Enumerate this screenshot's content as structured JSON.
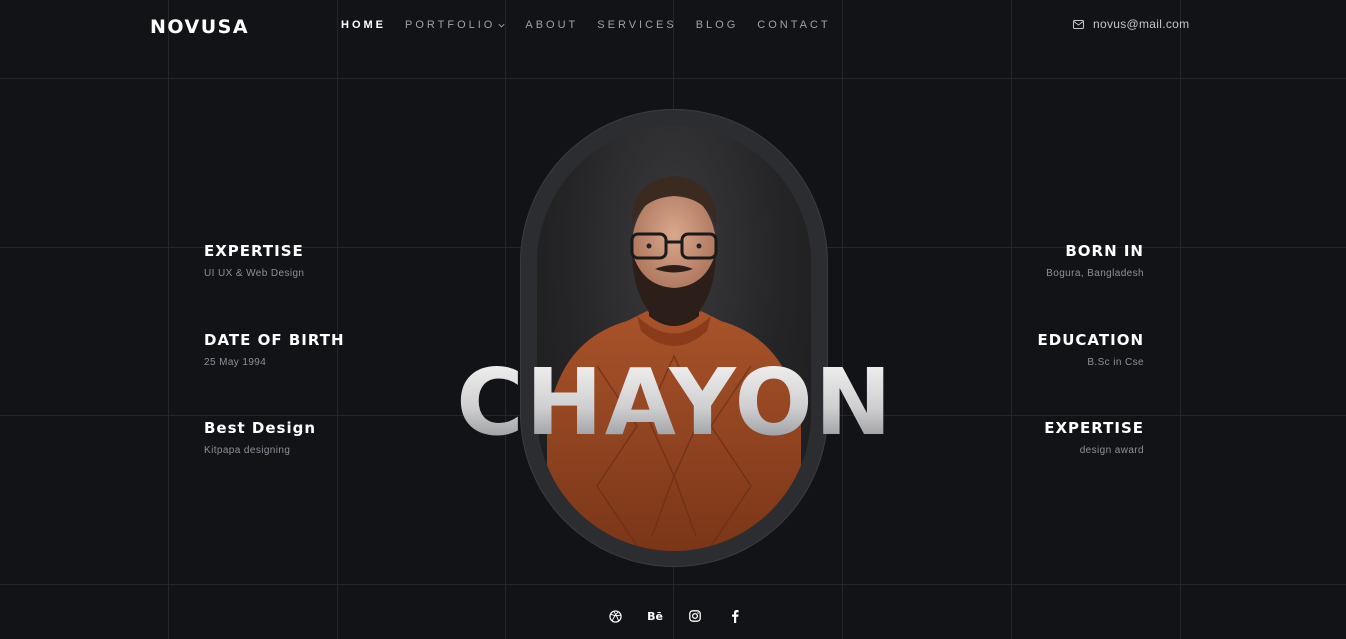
{
  "header": {
    "logo": "NOVUSA",
    "nav": [
      {
        "label": "HOME"
      },
      {
        "label": "PORTFOLIO"
      },
      {
        "label": "ABOUT"
      },
      {
        "label": "SERVICES"
      },
      {
        "label": "BLOG"
      },
      {
        "label": "CONTACT"
      }
    ],
    "email": "novus@mail.com"
  },
  "left_info": [
    {
      "title": "EXPERTISE",
      "value": "UI UX & Web Design"
    },
    {
      "title": "DATE OF BIRTH",
      "value": "25 May 1994"
    },
    {
      "title": "Best Design",
      "value": "Kitpapa designing"
    }
  ],
  "right_info": [
    {
      "title": "BORN IN",
      "value": "Bogura, Bangladesh"
    },
    {
      "title": "EDUCATION",
      "value": "B.Sc in Cse"
    },
    {
      "title": "EXPERTISE",
      "value": "design award"
    }
  ],
  "hero": {
    "name": "CHAYON"
  },
  "social": {
    "behance_label": "Bē",
    "icons": [
      "dribbble-icon",
      "behance-icon",
      "instagram-icon",
      "facebook-icon"
    ]
  },
  "colors": {
    "background": "#121317",
    "sweater": "#9a4a22",
    "grid_line": "#24262c"
  }
}
